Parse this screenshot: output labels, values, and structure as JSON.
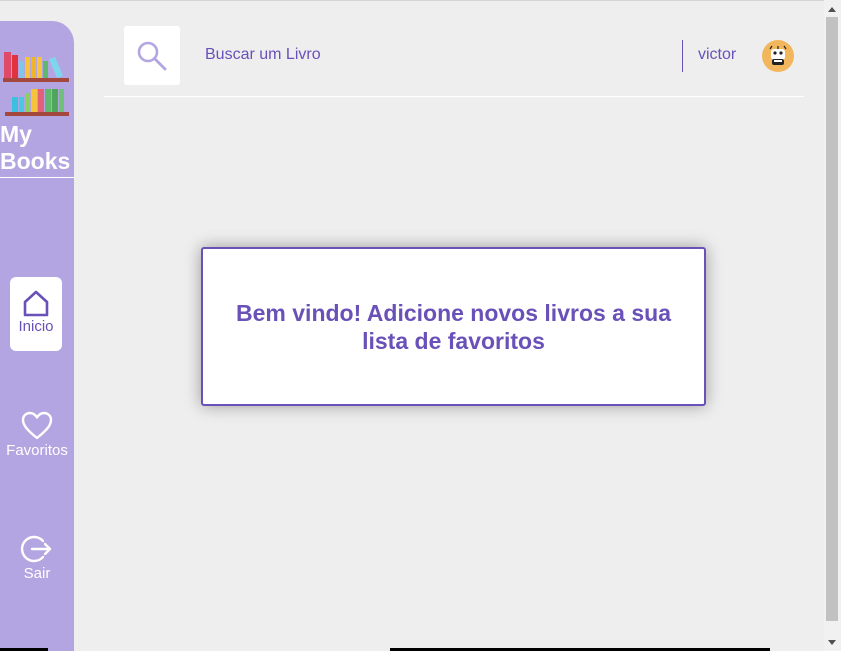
{
  "sidebar": {
    "brand_line1": "My",
    "brand_line2": "Books",
    "items": [
      {
        "label": "Inicio",
        "icon": "home-icon",
        "active": true
      },
      {
        "label": "Favoritos",
        "icon": "heart-icon",
        "active": false
      },
      {
        "label": "Sair",
        "icon": "logout-icon",
        "active": false
      }
    ]
  },
  "header": {
    "search_placeholder": "Buscar um Livro",
    "username": "victor"
  },
  "main": {
    "welcome_message": "Bem vindo! Adicione novos livros a sua lista de favoritos"
  },
  "colors": {
    "accent": "#6a51b8",
    "sidebar_bg": "#b3a5e1",
    "page_bg": "#eeeeee"
  }
}
